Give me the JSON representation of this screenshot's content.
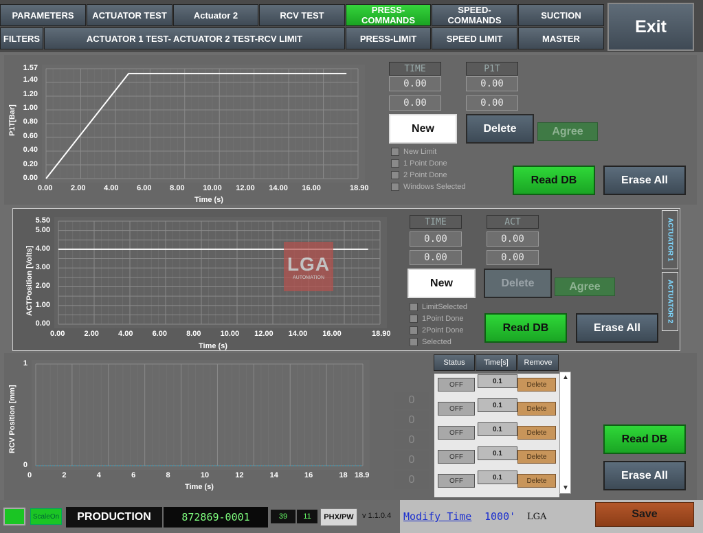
{
  "tabs_row1": [
    {
      "label": "PARAMETERS",
      "active": false
    },
    {
      "label": "ACTUATOR TEST",
      "active": false
    },
    {
      "label": "Actuator 2",
      "active": false
    },
    {
      "label": "RCV TEST",
      "active": false
    },
    {
      "label": "PRESS-COMMANDS",
      "active": true
    },
    {
      "label": "SPEED-COMMANDS",
      "active": false
    },
    {
      "label": "SUCTION",
      "active": false
    }
  ],
  "tabs_row2": [
    {
      "label": "FILTERS"
    },
    {
      "label": "ACTUATOR 1 TEST- ACTUATOR 2 TEST-RCV LIMIT"
    },
    {
      "label": "PRESS-LIMIT"
    },
    {
      "label": "SPEED LIMIT"
    },
    {
      "label": "MASTER"
    }
  ],
  "exit_label": "Exit",
  "colors": {
    "active_tab": "#22bb2a",
    "plot_line": "#ffffff",
    "save": "#a04a1e"
  },
  "pressure": {
    "ylabel": "P1T[Bar]",
    "xlabel": "Time (s)",
    "yticks": [
      "1.57",
      "1.40",
      "1.20",
      "1.00",
      "0.80",
      "0.60",
      "0.40",
      "0.20",
      "0.00"
    ],
    "xticks": [
      "0.00",
      "2.00",
      "4.00",
      "6.00",
      "8.00",
      "10.00",
      "12.00",
      "14.00",
      "16.00",
      "18.90"
    ],
    "hdr_time": "TIME",
    "hdr_p": "P1T",
    "time_vals": [
      "0.00",
      "0.00"
    ],
    "p_vals": [
      "0.00",
      "0.00"
    ],
    "new_label": "New",
    "delete_label": "Delete",
    "agree_label": "Agree",
    "checks": [
      "New Limit",
      "1 Point Done",
      "2 Point Done",
      "Windows Selected"
    ],
    "read_label": "Read DB",
    "erase_label": "Erase All"
  },
  "actuator": {
    "ylabel": "ACTPosition [Volts]",
    "xlabel": "Time (s)",
    "yticks": [
      "5.50",
      "5.00",
      "4.00",
      "3.00",
      "2.00",
      "1.00",
      "0.00"
    ],
    "xticks": [
      "0.00",
      "2.00",
      "4.00",
      "6.00",
      "8.00",
      "10.00",
      "12.00",
      "14.00",
      "16.00",
      "18.90"
    ],
    "hdr_time": "TIME",
    "hdr_act": "ACT",
    "time_vals": [
      "0.00",
      "0.00"
    ],
    "act_vals": [
      "0.00",
      "0.00"
    ],
    "new_label": "New",
    "delete_label": "Delete",
    "agree_label": "Agree",
    "checks": [
      "LimitSelected",
      "1Point Done",
      "2Point Done",
      "Selected"
    ],
    "read_label": "Read DB",
    "erase_label": "Erase All",
    "side_tab1": "ACTUATOR 1",
    "side_tab2": "ACTUATOR 2",
    "watermark_logo": "LGA",
    "watermark_sub": "AUTOMATION"
  },
  "rcv": {
    "ylabel": "RCV Position [mm]",
    "xlabel": "Time (s)",
    "yticks": [
      "1",
      "0"
    ],
    "xticks": [
      "0",
      "2",
      "4",
      "6",
      "8",
      "10",
      "12",
      "14",
      "16",
      "18",
      "18.9"
    ],
    "col_status": "Status",
    "col_time": "Time[s]",
    "col_remove": "Remove",
    "zeros": [
      "0",
      "0",
      "0",
      "0",
      "0"
    ],
    "rows": [
      {
        "status": "OFF",
        "time": "0.1",
        "remove": "Delete"
      },
      {
        "status": "OFF",
        "time": "0.1",
        "remove": "Delete"
      },
      {
        "status": "OFF",
        "time": "0.1",
        "remove": "Delete"
      },
      {
        "status": "OFF",
        "time": "0.1",
        "remove": "Delete"
      },
      {
        "status": "OFF",
        "time": "0.1",
        "remove": "Delete"
      }
    ],
    "read_label": "Read DB",
    "erase_label": "Erase All"
  },
  "chart_data": [
    {
      "type": "line",
      "title": "",
      "xlabel": "Time (s)",
      "ylabel": "P1T[Bar]",
      "xlim": [
        0,
        18.9
      ],
      "ylim": [
        0,
        1.57
      ],
      "grid": true,
      "series": [
        {
          "x": [
            0,
            5,
            18.2
          ],
          "y": [
            0,
            1.5,
            1.5
          ]
        }
      ]
    },
    {
      "type": "line",
      "title": "",
      "xlabel": "Time (s)",
      "ylabel": "ACTPosition [Volts]",
      "xlim": [
        0,
        18.9
      ],
      "ylim": [
        0,
        5.5
      ],
      "grid": true,
      "series": [
        {
          "x": [
            0,
            18.2
          ],
          "y": [
            4,
            4
          ]
        }
      ]
    },
    {
      "type": "line",
      "title": "",
      "xlabel": "Time (s)",
      "ylabel": "RCV Position [mm]",
      "xlim": [
        0,
        18.9
      ],
      "ylim": [
        0,
        1
      ],
      "grid": true,
      "series": [
        {
          "x": [
            0,
            18.9
          ],
          "y": [
            0,
            0
          ]
        }
      ]
    }
  ],
  "status": {
    "scale_label": "ScaleOn",
    "mode_label": "PRODUCTION",
    "serial": "872869-0001",
    "num1": "39",
    "num2": "11",
    "model": "PHX/PW",
    "version": "v 1.1.0.4",
    "modify_link": "Modify Time",
    "modify_value": "1000'",
    "company": "LGA",
    "save_label": "Save"
  }
}
